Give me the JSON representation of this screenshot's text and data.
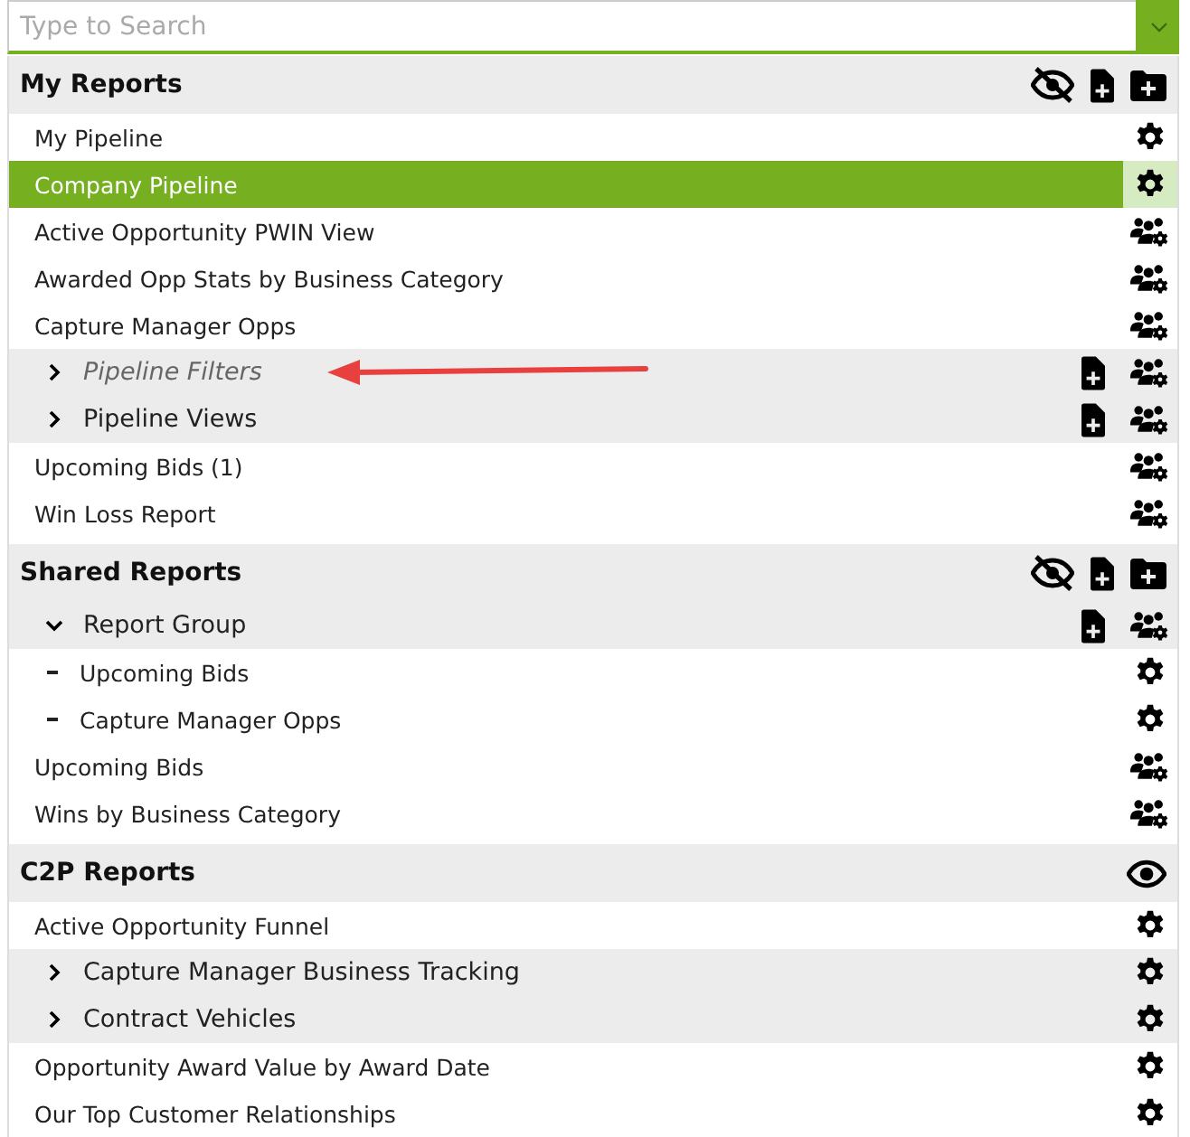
{
  "search": {
    "placeholder": "Type to Search"
  },
  "sections": [
    {
      "title": "My Reports",
      "hidden": true,
      "can_add": true,
      "rows": [
        {
          "label": "My Pipeline",
          "selected": false,
          "shared": false
        },
        {
          "label": "Company Pipeline",
          "selected": true,
          "shared": false
        },
        {
          "label": "Active Opportunity PWIN View",
          "selected": false,
          "shared": true
        },
        {
          "label": "Awarded Opp Stats by Business Category",
          "selected": false,
          "shared": true
        },
        {
          "label": "Capture Manager Opps",
          "selected": false,
          "shared": true
        },
        {
          "label": "Pipeline Filters",
          "kind": "group",
          "expanded": false,
          "muted": true,
          "can_add": true,
          "shared": true,
          "selected": false,
          "annotated": true
        },
        {
          "label": "Pipeline Views",
          "kind": "group",
          "expanded": false,
          "muted": false,
          "can_add": true,
          "shared": true,
          "selected": false
        },
        {
          "label": "Upcoming Bids (1)",
          "selected": false,
          "shared": true
        },
        {
          "label": "Win Loss Report",
          "selected": false,
          "shared": true
        }
      ]
    },
    {
      "title": "Shared Reports",
      "hidden": true,
      "can_add": true,
      "rows": [
        {
          "label": "Report Group",
          "kind": "group",
          "expanded": true,
          "muted": false,
          "can_add": true,
          "shared": true,
          "selected": false,
          "children": [
            {
              "label": "Upcoming Bids",
              "selected": false,
              "shared": false
            },
            {
              "label": "Capture Manager Opps",
              "selected": false,
              "shared": false
            }
          ]
        },
        {
          "label": "Upcoming Bids",
          "selected": false,
          "shared": true
        },
        {
          "label": "Wins by Business Category",
          "selected": false,
          "shared": true
        }
      ]
    },
    {
      "title": "C2P Reports",
      "hidden": false,
      "can_add": false,
      "rows": [
        {
          "label": "Active Opportunity Funnel",
          "selected": false,
          "shared": false
        },
        {
          "label": "Capture Manager Business Tracking",
          "kind": "group",
          "expanded": false,
          "muted": false,
          "can_add": false,
          "shared": false,
          "selected": false
        },
        {
          "label": "Contract Vehicles",
          "kind": "group",
          "expanded": false,
          "muted": false,
          "can_add": false,
          "shared": false,
          "selected": false
        },
        {
          "label": "Opportunity Award Value by Award Date",
          "selected": false,
          "shared": false
        },
        {
          "label": "Our Top Customer Relationships",
          "selected": false,
          "shared": false
        }
      ]
    }
  ]
}
